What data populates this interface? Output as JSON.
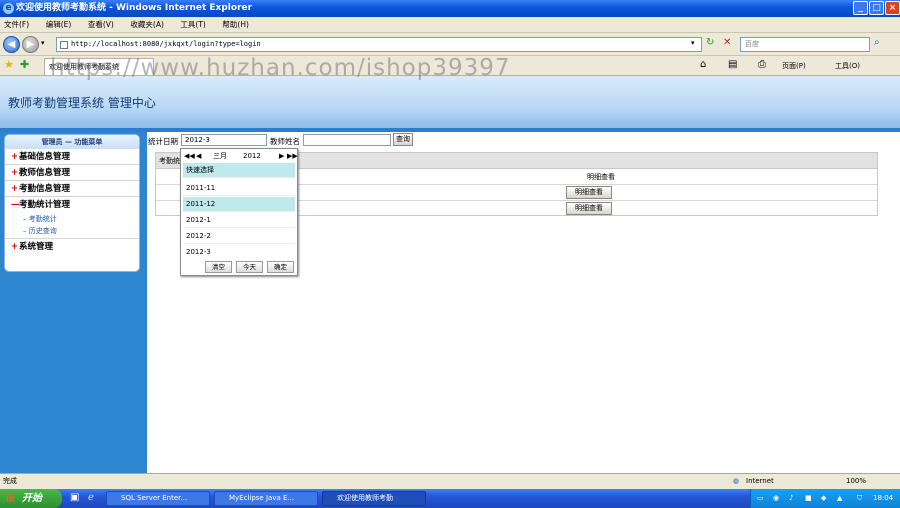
{
  "window": {
    "title": "欢迎使用教师考勤系统 - Windows Internet Explorer"
  },
  "menubar": {
    "items": [
      "文件(F)",
      "编辑(E)",
      "查看(V)",
      "收藏夹(A)",
      "工具(T)",
      "帮助(H)"
    ]
  },
  "address": {
    "url": "http://localhost:8080/jxkqxt/login?type=login",
    "search_placeholder": "百度"
  },
  "favorites": {
    "tab_title": "欢迎使用教师考勤系统",
    "page_label": "页面(P)",
    "tools_label": "工具(O)"
  },
  "watermark": "https://www.huzhan.com/ishop39397",
  "header": {
    "title": "教师考勤管理系统  管理中心"
  },
  "sidebar": {
    "menu_title": "管理员 — 功能菜单",
    "groups": [
      {
        "symbol": "+",
        "label": "基础信息管理"
      },
      {
        "symbol": "+",
        "label": "教师信息管理"
      },
      {
        "symbol": "+",
        "label": "考勤信息管理"
      },
      {
        "symbol": "—",
        "label": "考勤统计管理"
      }
    ],
    "subitems": [
      "考勤统计",
      "历史查询"
    ],
    "last_group": {
      "symbol": "+",
      "label": "系统管理"
    }
  },
  "filter": {
    "date_label": "统计日期",
    "date_value": "2012-3",
    "name_label": "教师姓名",
    "name_value": "",
    "query_button": "查询"
  },
  "table": {
    "first_header": "考勤统",
    "detail_header": "明细查看",
    "rows": [
      {
        "button": "明细查看"
      },
      {
        "button": "明细查看"
      }
    ]
  },
  "picker": {
    "nav_prev_year": "◀◀",
    "nav_prev": "◀",
    "month": "三月",
    "year": "2012",
    "nav_next": "▶",
    "nav_next_year": "▶▶",
    "quick_label": "快速选择",
    "options": [
      "2011-11",
      "2011-12",
      "2012-1",
      "2012-2",
      "2012-3"
    ],
    "clear": "清空",
    "today": "今天",
    "ok": "确定"
  },
  "statusbar": {
    "left": "完成",
    "zone": "Internet",
    "zoom": "100%"
  },
  "taskbar": {
    "start": "开始",
    "tasks": [
      "SQL Server Enter...",
      "MyEclipse Java E...",
      "欢迎使用教师考勤"
    ],
    "clock": "18:04"
  },
  "colors": {
    "sidebar": "#2e85d0",
    "title_bar": "#0a56d8",
    "header_text": "#153a78",
    "accent_red": "#d40000"
  }
}
